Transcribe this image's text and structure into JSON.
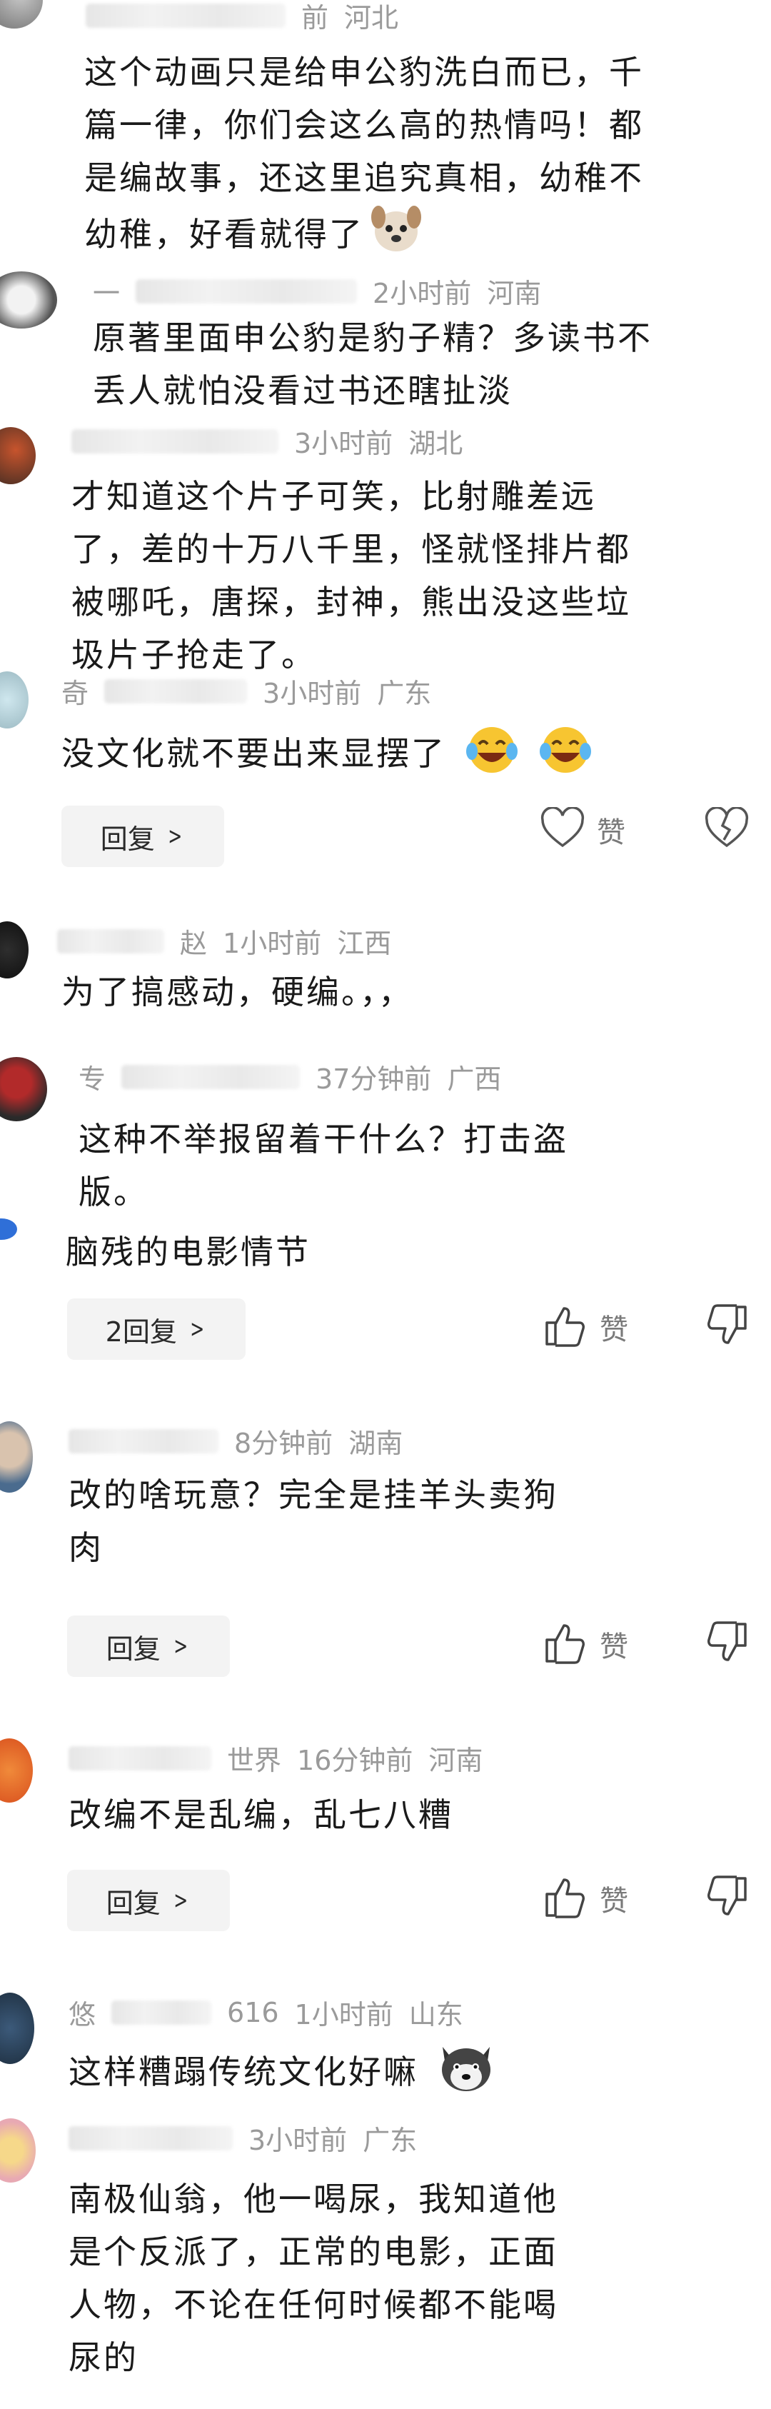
{
  "comments": [
    {
      "name_fragment": "",
      "time": "前",
      "location": "河北",
      "body_lines": [
        "这个动画只是给申公豹洗白而已，千",
        "篇一律，你们会这么高的热情吗！都",
        "是编故事，还这里追究真相，幼稚不",
        "幼稚，好看就得了"
      ],
      "emoji": "dog-face-icon"
    },
    {
      "name_fragment": "一",
      "time": "2小时前",
      "location": "河南",
      "body_lines": [
        "原著里面申公豹是豹子精？多读书不",
        "丢人就怕没看过书还瞎扯淡"
      ]
    },
    {
      "name_fragment": "",
      "time": "3小时前",
      "location": "湖北",
      "body_lines": [
        "才知道这个片子可笑，比射雕差远",
        "了，差的十万八千里，怪就怪排片都",
        "被哪吒，唐探，封神，熊出没这些垃",
        "圾片子抢走了。"
      ]
    },
    {
      "name_fragment": "奇",
      "time": "3小时前",
      "location": "广东",
      "body_lines": [
        "没文化就不要出来显摆了"
      ],
      "emoji": "laughing-crying-icon",
      "reply_label": "回复",
      "like_label": "赞"
    },
    {
      "name_fragment": "赵",
      "time": "1小时前",
      "location": "江西",
      "body_lines": [
        "为了搞感动，硬编。，，"
      ]
    },
    {
      "name_fragment": "专",
      "time": "37分钟前",
      "location": "广西",
      "body_lines": [
        "这种不举报留着干什么？打击盗",
        "版。"
      ]
    },
    {
      "body_lines": [
        "脑残的电影情节"
      ],
      "reply_label": "2回复",
      "like_label": "赞"
    },
    {
      "name_fragment": "",
      "time": "8分钟前",
      "location": "湖南",
      "body_lines": [
        "改的啥玩意？完全是挂羊头卖狗",
        "肉"
      ],
      "reply_label": "回复",
      "like_label": "赞"
    },
    {
      "name_fragment": "世界",
      "time": "16分钟前",
      "location": "河南",
      "body_lines": [
        "改编不是乱编，乱七八糟"
      ],
      "reply_label": "回复",
      "like_label": "赞"
    },
    {
      "name_fragment": "悠",
      "name_suffix": "616",
      "time": "1小时前",
      "location": "山东",
      "body_lines": [
        "这样糟蹋传统文化好嘛"
      ],
      "emoji": "husky-face-icon"
    },
    {
      "name_fragment": "",
      "time": "3小时前",
      "location": "广东",
      "body_lines": [
        "南极仙翁，他一喝尿，我知道他",
        "是个反派了，正常的电影，正面",
        "人物，不论在任何时候都不能喝",
        "尿的"
      ]
    }
  ],
  "icons": {
    "heart": "heart-outline-icon",
    "broken_heart": "broken-heart-icon",
    "thumbs_up": "thumbs-up-icon",
    "thumbs_down": "thumbs-down-icon",
    "chevron": "chevron-right-icon"
  }
}
